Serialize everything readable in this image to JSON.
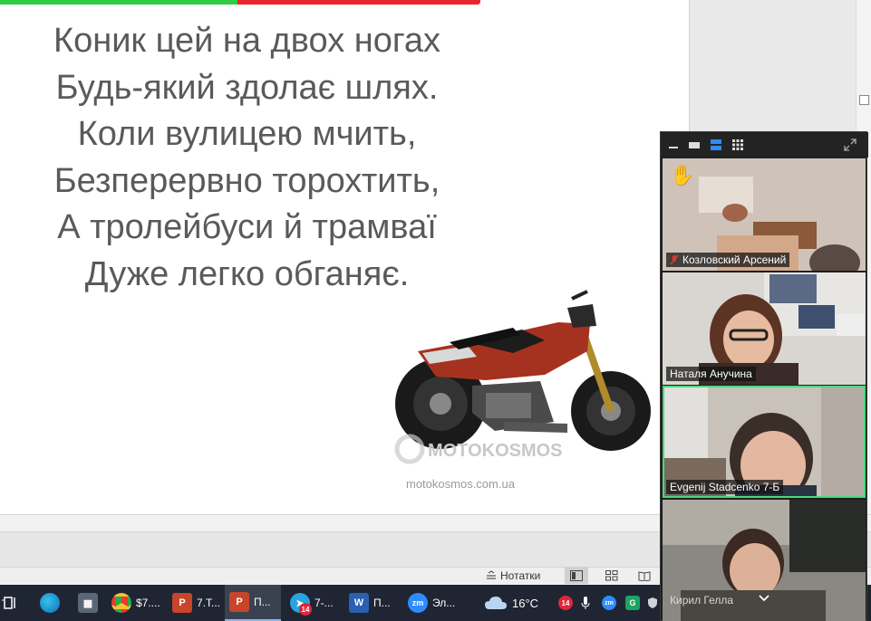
{
  "slide": {
    "poem": [
      "Коник цей на двох ногах",
      "Будь-який здолає шлях.",
      "Коли вулицею мчить,",
      "Безперервно торохтить,",
      "А тролейбуси й трамваї",
      "Дуже легко обганяє."
    ],
    "watermark": "motokosmos.com.ua",
    "logo_text": "MOTOKOSMOS"
  },
  "statusbar": {
    "notes_label": "Нотатки"
  },
  "zoom": {
    "participants": [
      {
        "name": "Козловский Арсений",
        "muted": true,
        "hand_raised": true
      },
      {
        "name": "Наталя Анучина",
        "muted": false
      },
      {
        "name": "Evgenij Stadcenko 7-Б",
        "muted": false,
        "active_speaker": true
      },
      {
        "name": "Кирил Гелла",
        "muted": false
      }
    ]
  },
  "taskbar": {
    "chrome_label": "$7....",
    "ppt1_label": "7.Т...",
    "ppt2_label": "П...",
    "telegram_label": "7-...",
    "telegram_badge": "14",
    "word_label": "П...",
    "zoom_label": "Эл...",
    "weather_temp": "16°C",
    "tray_badge": "14"
  },
  "colors": {
    "accent_green": "#2ecc40",
    "accent_red": "#e8262b",
    "taskbar_bg": "#1f2533",
    "zoom_speaker_outline": "#4bd77d"
  }
}
